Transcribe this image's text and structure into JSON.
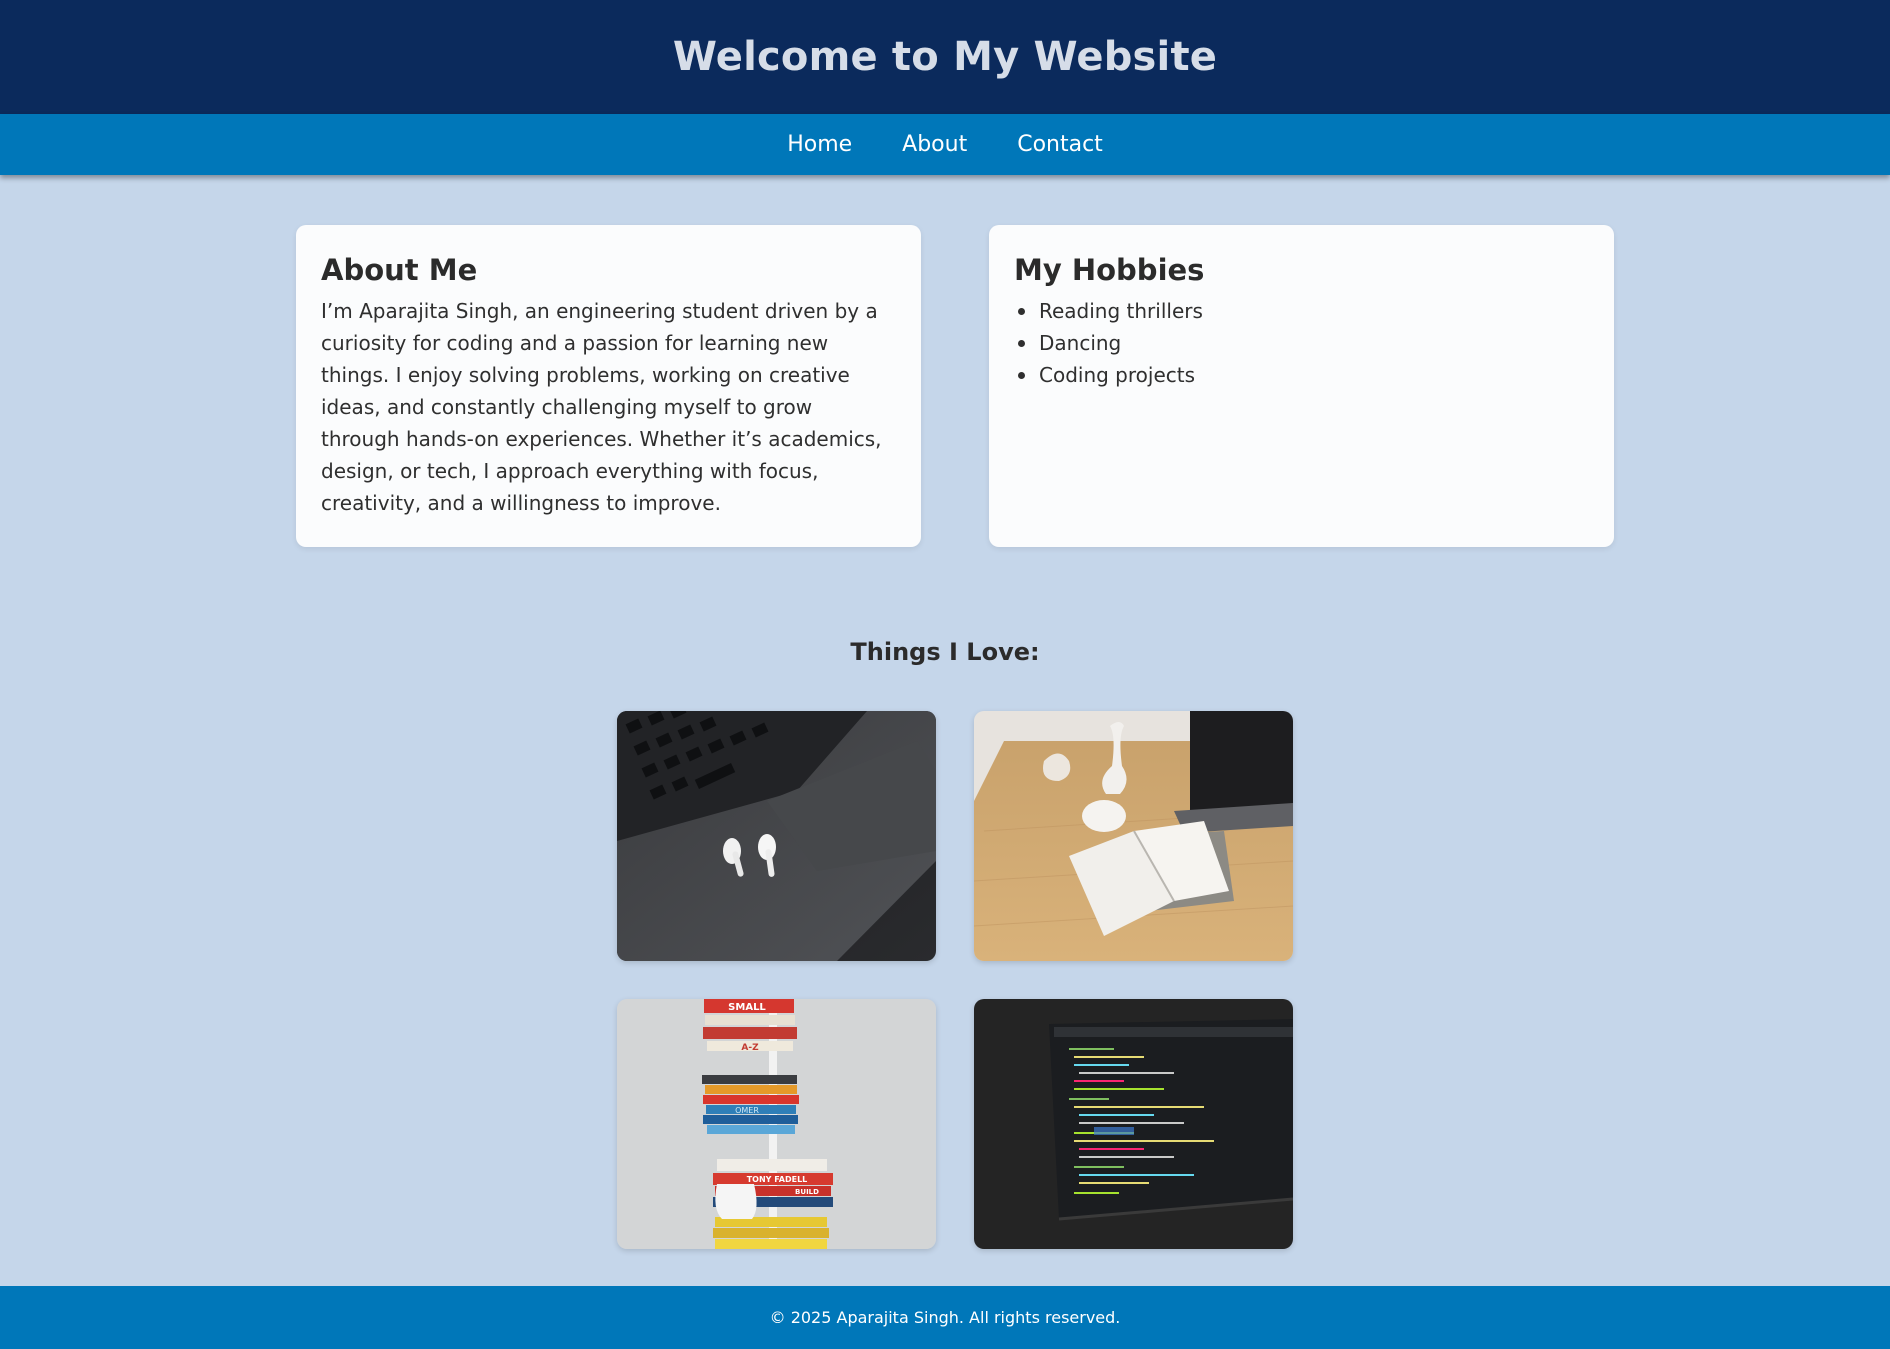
{
  "header": {
    "title": "Welcome to My Website"
  },
  "nav": {
    "items": [
      {
        "label": "Home"
      },
      {
        "label": "About"
      },
      {
        "label": "Contact"
      }
    ]
  },
  "about": {
    "heading": "About Me",
    "body": "I’m Aparajita Singh, an engineering student driven by a curiosity for coding and a passion for learning new things. I enjoy solving problems, working on creative ideas, and constantly challenging myself to grow through hands-on experiences. Whether it’s academics, design, or tech, I approach everything with focus, creativity, and a willingness to improve."
  },
  "hobbies": {
    "heading": "My Hobbies",
    "items": [
      "Reading thrillers",
      "Dancing",
      "Coding projects"
    ]
  },
  "gallery": {
    "title": "Things I Love:",
    "photos": [
      {
        "subject": "earbuds-on-laptop"
      },
      {
        "subject": "desk-with-notebook"
      },
      {
        "subject": "stacked-books"
      },
      {
        "subject": "code-on-screen"
      }
    ],
    "book_spine_labels": [
      "SMALL",
      "A-Z",
      "OMER",
      "TONY FADELL",
      "BUILD"
    ]
  },
  "footer": {
    "text": "© 2025 Aparajita Singh. All rights reserved."
  },
  "colors": {
    "header_bg": "#0b2a5c",
    "nav_bg": "#0077b9",
    "page_bg": "#c5d6ea",
    "card_bg": "#fbfcfd",
    "footer_bg": "#0077b9"
  }
}
